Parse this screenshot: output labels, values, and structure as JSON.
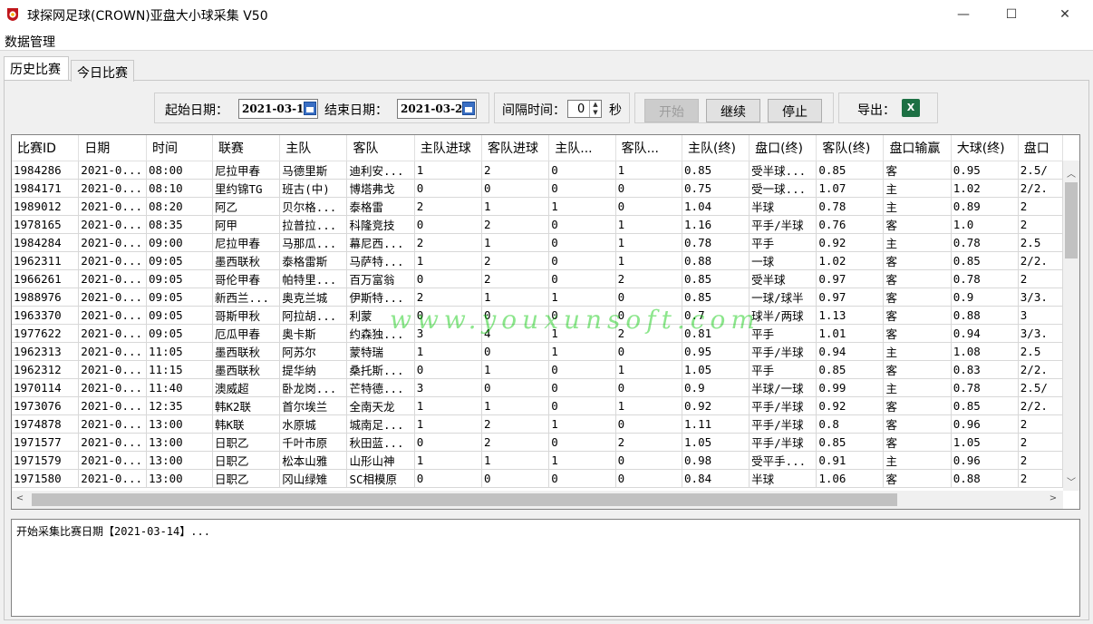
{
  "window": {
    "title": "球探网足球(CROWN)亚盘大小球采集 V50",
    "min_glyph": "—",
    "max_glyph": "☐",
    "close_glyph": "✕"
  },
  "menu": {
    "data_mgmt": "数据管理"
  },
  "tabs": {
    "history": "历史比赛",
    "today": "今日比赛"
  },
  "toolbar": {
    "start_label": "起始日期：",
    "start_date": "2021-03-14",
    "end_label": "结束日期：",
    "end_date": "2021-03-21",
    "interval_label": "间隔时间：",
    "interval_value": "0",
    "interval_unit": "秒",
    "start_button": "开始",
    "continue_button": "继续",
    "stop_button": "停止",
    "export_label": "导出：",
    "export_icon": "excel-icon"
  },
  "grid": {
    "columns": [
      "比赛ID",
      "日期",
      "时间",
      "联赛",
      "主队",
      "客队",
      "主队进球",
      "客队进球",
      "主队...",
      "客队...",
      "主队(终)",
      "盘口(终)",
      "客队(终)",
      "盘口输赢",
      "大球(终)",
      "盘口"
    ],
    "rows": [
      [
        "1984286",
        "2021-0...",
        "08:00",
        "尼拉甲春",
        "马德里斯",
        "迪利安...",
        "1",
        "2",
        "0",
        "1",
        "0.85",
        "受半球...",
        "0.85",
        "客",
        "0.95",
        "2.5/"
      ],
      [
        "1984171",
        "2021-0...",
        "08:10",
        "里约锦TG",
        "班古(中)",
        "博塔弗戈",
        "0",
        "0",
        "0",
        "0",
        "0.75",
        "受一球...",
        "1.07",
        "主",
        "1.02",
        "2/2."
      ],
      [
        "1989012",
        "2021-0...",
        "08:20",
        "阿乙",
        "贝尔格...",
        "泰格雷",
        "2",
        "1",
        "1",
        "0",
        "1.04",
        "半球",
        "0.78",
        "主",
        "0.89",
        "2"
      ],
      [
        "1978165",
        "2021-0...",
        "08:35",
        "阿甲",
        "拉普拉...",
        "科隆竞技",
        "0",
        "2",
        "0",
        "1",
        "1.16",
        "平手/半球",
        "0.76",
        "客",
        "1.0",
        "2"
      ],
      [
        "1984284",
        "2021-0...",
        "09:00",
        "尼拉甲春",
        "马那瓜...",
        "幕尼西...",
        "2",
        "1",
        "0",
        "1",
        "0.78",
        "平手",
        "0.92",
        "主",
        "0.78",
        "2.5"
      ],
      [
        "1962311",
        "2021-0...",
        "09:05",
        "墨西联秋",
        "泰格雷斯",
        "马萨特...",
        "1",
        "2",
        "0",
        "1",
        "0.88",
        "一球",
        "1.02",
        "客",
        "0.85",
        "2/2."
      ],
      [
        "1966261",
        "2021-0...",
        "09:05",
        "哥伦甲春",
        "帕特里...",
        "百万富翁",
        "0",
        "2",
        "0",
        "2",
        "0.85",
        "受半球",
        "0.97",
        "客",
        "0.78",
        "2"
      ],
      [
        "1988976",
        "2021-0...",
        "09:05",
        "新西兰...",
        "奥克兰城",
        "伊斯特...",
        "2",
        "1",
        "1",
        "0",
        "0.85",
        "一球/球半",
        "0.97",
        "客",
        "0.9",
        "3/3."
      ],
      [
        "1963370",
        "2021-0...",
        "09:05",
        "哥斯甲秋",
        "阿拉胡...",
        "利蒙",
        "0",
        "0",
        "0",
        "0",
        "0.7",
        "球半/两球",
        "1.13",
        "客",
        "0.88",
        "3"
      ],
      [
        "1977622",
        "2021-0...",
        "09:05",
        "厄瓜甲春",
        "奥卡斯",
        "约森独...",
        "3",
        "4",
        "1",
        "2",
        "0.81",
        "平手",
        "1.01",
        "客",
        "0.94",
        "3/3."
      ],
      [
        "1962313",
        "2021-0...",
        "11:05",
        "墨西联秋",
        "阿苏尔",
        "蒙特瑞",
        "1",
        "0",
        "1",
        "0",
        "0.95",
        "平手/半球",
        "0.94",
        "主",
        "1.08",
        "2.5"
      ],
      [
        "1962312",
        "2021-0...",
        "11:15",
        "墨西联秋",
        "提华纳",
        "桑托斯...",
        "0",
        "1",
        "0",
        "1",
        "1.05",
        "平手",
        "0.85",
        "客",
        "0.83",
        "2/2."
      ],
      [
        "1970114",
        "2021-0...",
        "11:40",
        "澳威超",
        "卧龙岗...",
        "芒特德...",
        "3",
        "0",
        "0",
        "0",
        "0.9",
        "半球/一球",
        "0.99",
        "主",
        "0.78",
        "2.5/"
      ],
      [
        "1973076",
        "2021-0...",
        "12:35",
        "韩K2联",
        "首尔埃兰",
        "全南天龙",
        "1",
        "1",
        "0",
        "1",
        "0.92",
        "平手/半球",
        "0.92",
        "客",
        "0.85",
        "2/2."
      ],
      [
        "1974878",
        "2021-0...",
        "13:00",
        "韩K联",
        "水原城",
        "城南足...",
        "1",
        "2",
        "1",
        "0",
        "1.11",
        "平手/半球",
        "0.8",
        "客",
        "0.96",
        "2"
      ],
      [
        "1971577",
        "2021-0...",
        "13:00",
        "日职乙",
        "千叶市原",
        "秋田蓝...",
        "0",
        "2",
        "0",
        "2",
        "1.05",
        "平手/半球",
        "0.85",
        "客",
        "1.05",
        "2"
      ],
      [
        "1971579",
        "2021-0...",
        "13:00",
        "日职乙",
        "松本山雅",
        "山形山神",
        "1",
        "1",
        "1",
        "0",
        "0.98",
        "受平手...",
        "0.91",
        "主",
        "0.96",
        "2"
      ],
      [
        "1971580",
        "2021-0...",
        "13:00",
        "日职乙",
        "冈山绿雉",
        "SC相模原",
        "0",
        "0",
        "0",
        "0",
        "0.84",
        "半球",
        "1.06",
        "客",
        "0.88",
        "2"
      ]
    ]
  },
  "watermark": "www.youxunsoft.com",
  "log": {
    "text": "开始采集比赛日期【2021-03-14】..."
  }
}
